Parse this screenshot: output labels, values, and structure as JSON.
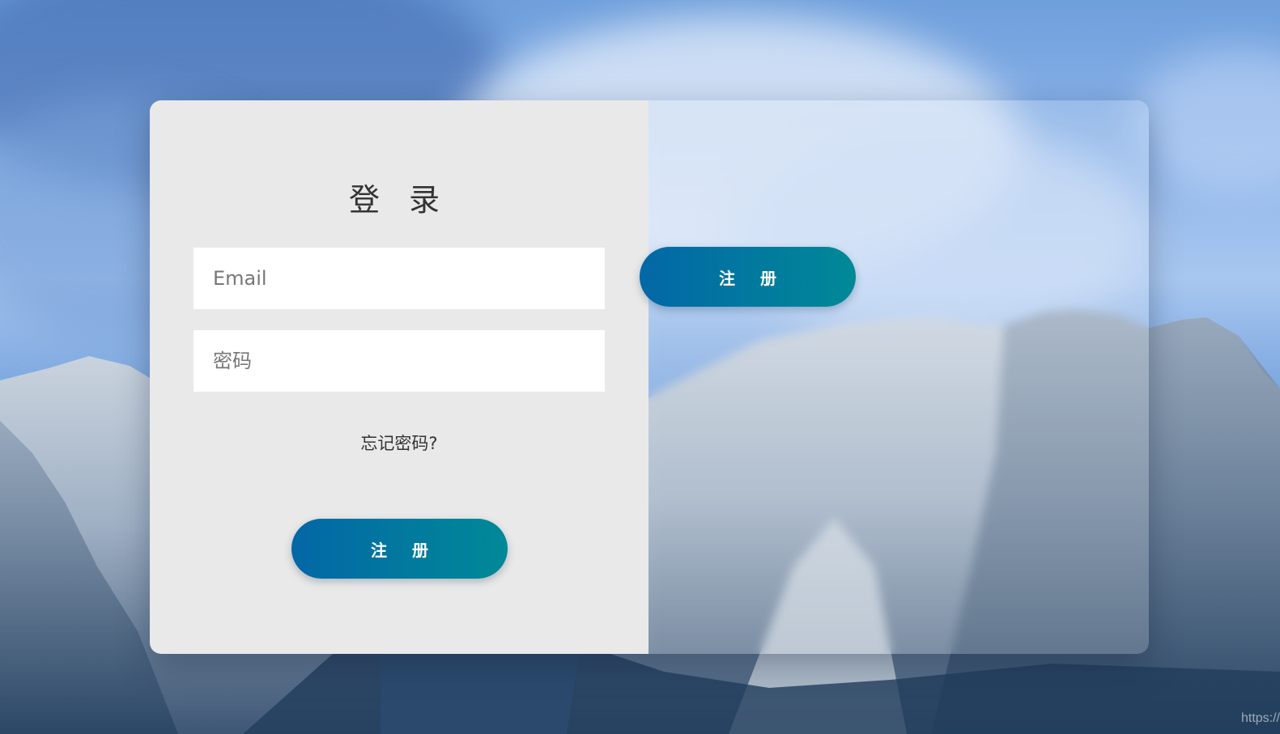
{
  "login_panel": {
    "title": "登 录",
    "email_placeholder": "Email",
    "password_placeholder": "密码",
    "forgot_password": "忘记密码?",
    "submit_label": "注 册"
  },
  "overlay_panel": {
    "switch_label": "注 册"
  },
  "watermark": "https://",
  "colors": {
    "panel_bg": "#e9e9e9",
    "button_gradient_start": "#0367a6",
    "button_gradient_end": "#008997",
    "button_text": "#ffffff"
  }
}
